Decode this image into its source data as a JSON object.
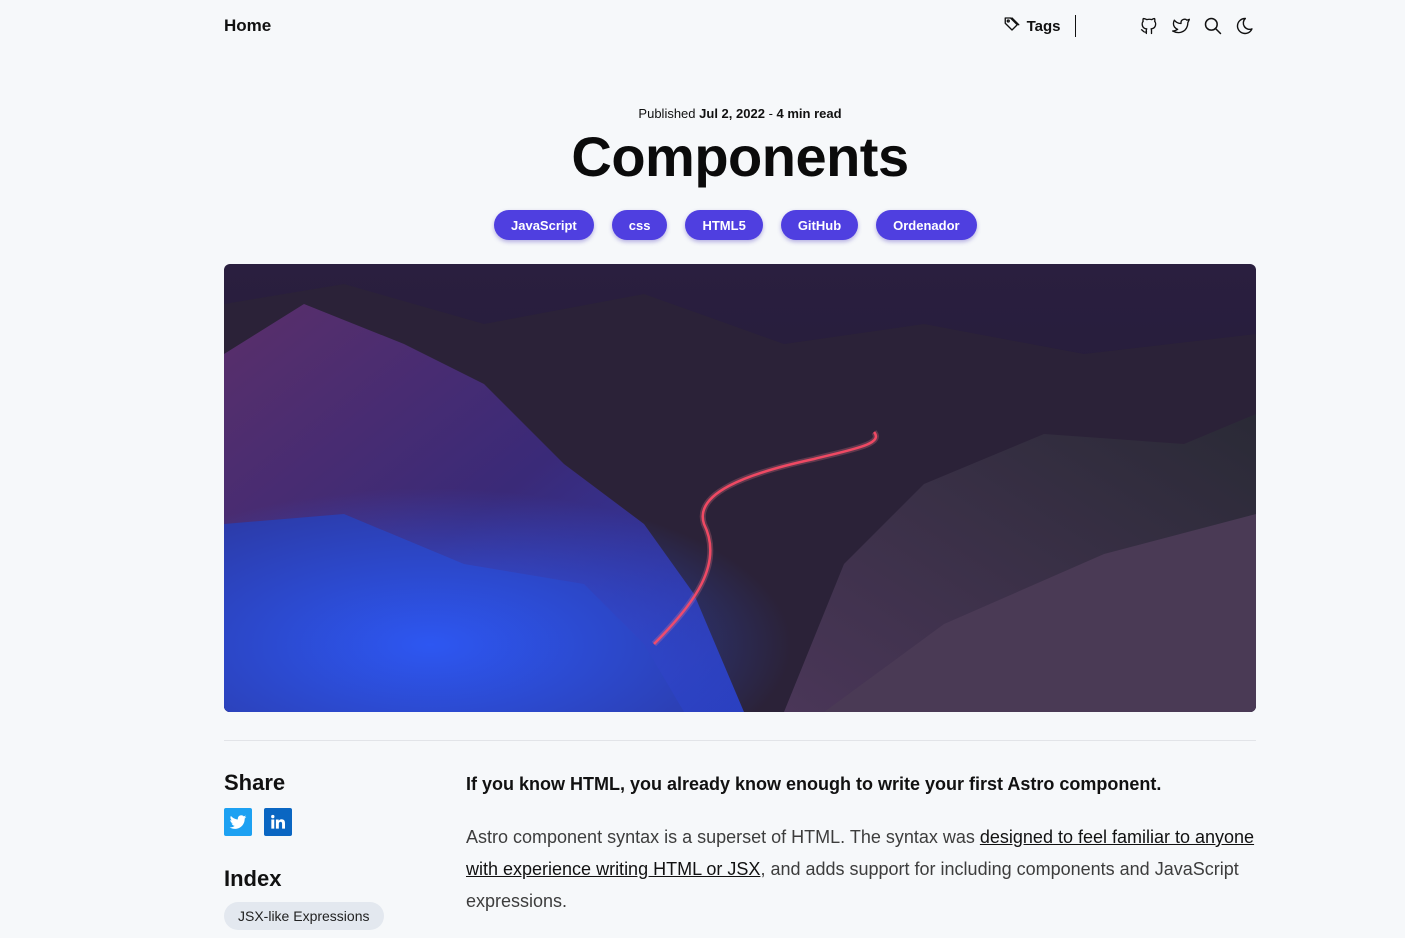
{
  "nav": {
    "home": "Home",
    "tags": "Tags"
  },
  "post": {
    "published_prefix": "Published",
    "date": "Jul 2, 2022",
    "separator": "-",
    "read_time": "4 min read",
    "title": "Components",
    "tags": [
      "JavaScript",
      "css",
      "HTML5",
      "GitHub",
      "Ordenador"
    ]
  },
  "sidebar": {
    "share_heading": "Share",
    "index_heading": "Index",
    "index_items": [
      "JSX-like Expressions"
    ]
  },
  "content": {
    "lead": "If you know HTML, you already know enough to write your first Astro component.",
    "para_before": "Astro component syntax is a superset of HTML. The syntax was ",
    "para_link": "designed to feel familiar to anyone with experience writing HTML or JSX",
    "para_after": ", and adds support for including components and JavaScript expressions."
  },
  "colors": {
    "accent": "#4f3fe0",
    "background": "#f6f8fa",
    "twitter": "#1da1f2",
    "linkedin": "#0a66c2"
  }
}
